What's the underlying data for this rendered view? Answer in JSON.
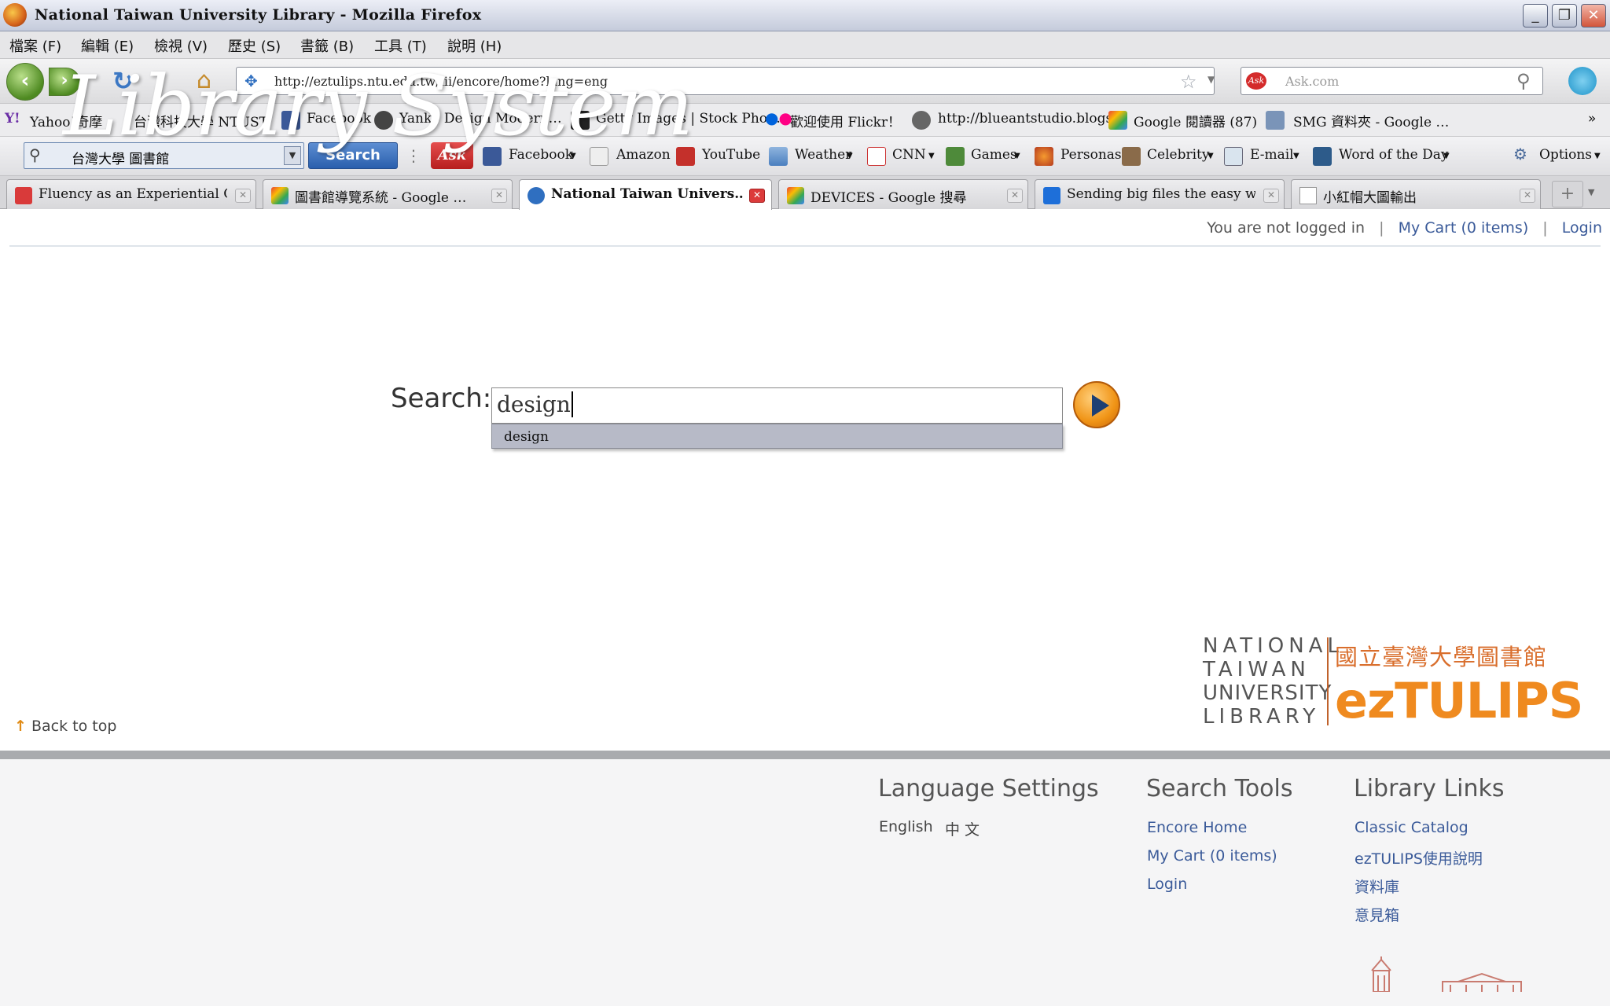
{
  "window": {
    "title": "National Taiwan University Library - Mozilla Firefox"
  },
  "menu": [
    "檔案 (F)",
    "編輯 (E)",
    "檢視 (V)",
    "歷史 (S)",
    "書籤 (B)",
    "工具 (T)",
    "說明 (H)"
  ],
  "nav": {
    "url": "http://eztulips.ntu.edu.tw/iii/encore/home?lang=eng",
    "search_placeholder": "Ask.com"
  },
  "bookmarks": [
    "Yahoo!奇摩",
    "台灣科技大學 NTUST",
    "Facebook",
    "Yanko Design Modern…",
    "Getty Images | Stock Pho…",
    "歡迎使用 Flickr！",
    "http://blueantstudio.blogs…",
    "Google 閱讀器 (87)",
    "SMG 資料夾 - Google …"
  ],
  "toolbar": {
    "search_value": "台灣大學 圖書館",
    "search_button": "Search",
    "items": [
      "Facebook",
      "Amazon",
      "YouTube",
      "Weather",
      "CNN",
      "Games",
      "Personas",
      "Celebrity",
      "E-mail",
      "Word of the Day"
    ],
    "options": "Options"
  },
  "tabs": [
    {
      "label": "Fluency as an Experiential Qu…",
      "active": false
    },
    {
      "label": "圖書館導覽系統 - Google …",
      "active": false
    },
    {
      "label": "National Taiwan Univers…",
      "active": true
    },
    {
      "label": "DEVICES - Google 搜尋",
      "active": false
    },
    {
      "label": "Sending big files the easy way…",
      "active": false
    },
    {
      "label": "小紅帽大圖輸出",
      "active": false
    }
  ],
  "page": {
    "not_logged": "You are not logged in",
    "cart": "My Cart (0 items)",
    "login": "Login",
    "search_label": "Search:",
    "search_value": "design",
    "suggestion": "design",
    "back_to_top": "Back to top",
    "logo": {
      "en": [
        "NATIONAL",
        "TAIWAN",
        "UNIVERSITY",
        "LIBRARY"
      ],
      "zh": "國立臺灣大學圖書館",
      "brand": "ezTULIPS"
    }
  },
  "footer": {
    "language": {
      "title": "Language Settings",
      "english": "English",
      "chinese": "中 文"
    },
    "tools": {
      "title": "Search Tools",
      "links": [
        "Encore Home",
        "My Cart (0 items)",
        "Login"
      ]
    },
    "library": {
      "title": "Library Links",
      "links": [
        "Classic Catalog",
        "ezTULIPS使用說明",
        "資料庫",
        "意見箱"
      ]
    }
  },
  "overlay_text": "Library System",
  "colors": {
    "accent": "#ef8a1f",
    "link": "#3a5a99",
    "footer_bg": "#f5f5f6"
  }
}
